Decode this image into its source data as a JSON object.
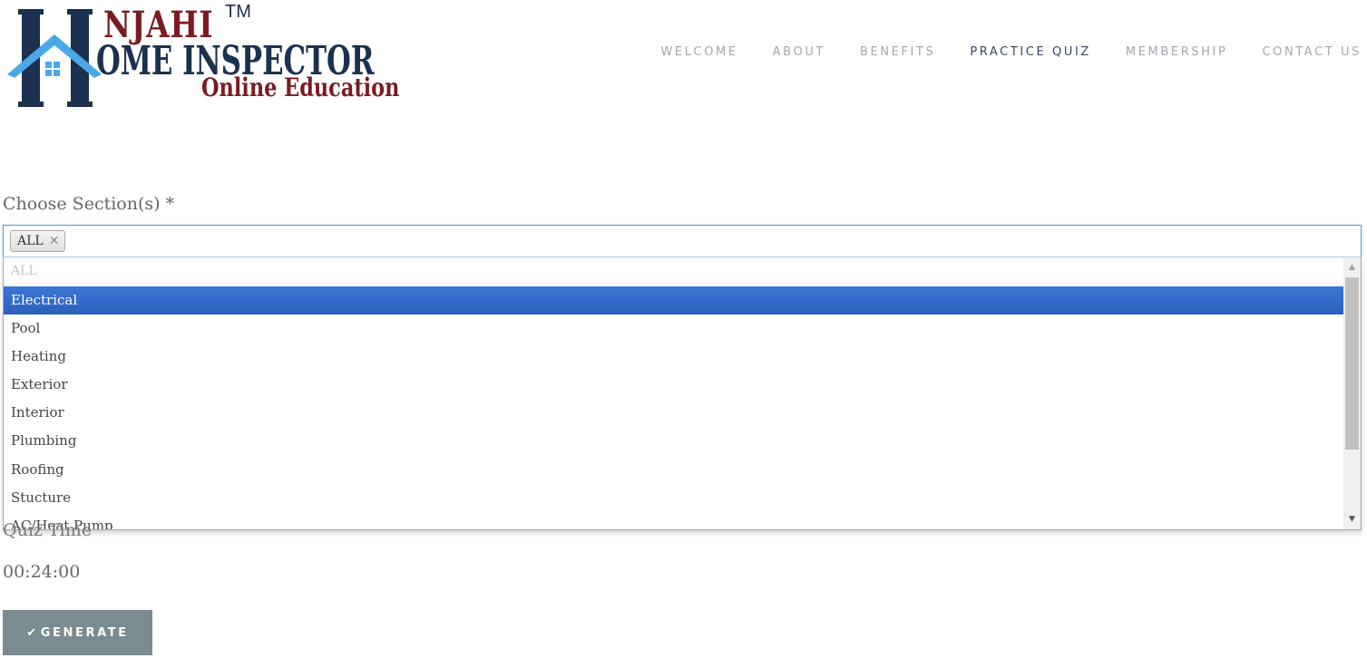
{
  "logo": {
    "line1": "NJAHI",
    "trademark": "TM",
    "line2": "OME INSPECTOR",
    "line3": "Online Education",
    "colors": {
      "navy": "#1b3150",
      "maroon": "#7a1c22",
      "sky": "#4aa8e8"
    }
  },
  "nav": {
    "items": [
      {
        "label": "WELCOME",
        "active": false
      },
      {
        "label": "ABOUT",
        "active": false
      },
      {
        "label": "BENEFITS",
        "active": false
      },
      {
        "label": "PRACTICE QUIZ",
        "active": true
      },
      {
        "label": "MEMBERSHIP",
        "active": false
      },
      {
        "label": "CONTACT US",
        "active": false
      }
    ]
  },
  "form": {
    "sections_label": "Choose Section(s) *",
    "selected_chips": [
      {
        "label": "ALL",
        "remove_icon": "close-icon"
      }
    ],
    "options": [
      {
        "label": "ALL",
        "state": "disabled"
      },
      {
        "label": "Electrical",
        "state": "highlighted"
      },
      {
        "label": "Pool",
        "state": "normal"
      },
      {
        "label": "Heating",
        "state": "normal"
      },
      {
        "label": "Exterior",
        "state": "normal"
      },
      {
        "label": "Interior",
        "state": "normal"
      },
      {
        "label": "Plumbing",
        "state": "normal"
      },
      {
        "label": "Roofing",
        "state": "normal"
      },
      {
        "label": "Stucture",
        "state": "normal"
      },
      {
        "label": "AC/Heat Pump",
        "state": "normal"
      }
    ],
    "quiz_time_label": "Quiz Time",
    "quiz_time_value": "00:24:00",
    "generate_button": {
      "icon": "check-icon",
      "label": "GENERATE"
    }
  },
  "colors": {
    "highlight": "#3169c6",
    "button": "#7b8b92",
    "nav_active": "#3d4663",
    "nav_inactive": "#a3a7ad"
  }
}
